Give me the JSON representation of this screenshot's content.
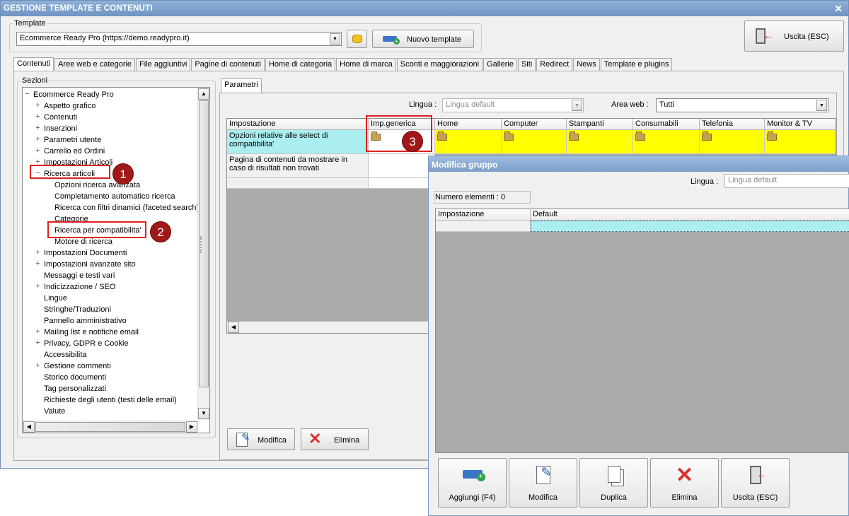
{
  "window": {
    "title": "GESTIONE TEMPLATE E CONTENUTI",
    "close": "✕"
  },
  "template_group": {
    "legend": "Template",
    "selected": "Ecommerce Ready Pro (https://demo.readypro.it)",
    "new_button": "Nuovo template"
  },
  "exit_button": "Uscita (ESC)",
  "tabs": [
    "Contenuti",
    "Aree web e categorie",
    "File aggiuntivi",
    "Pagine di contenuti",
    "Home di categoria",
    "Home di marca",
    "Sconti e maggiorazioni",
    "Gallerie",
    "Siti",
    "Redirect",
    "News",
    "Template e plugins"
  ],
  "sections": {
    "legend": "Sezioni",
    "root": "Ecommerce Ready Pro",
    "items": [
      {
        "label": "Aspetto grafico",
        "exp": "+"
      },
      {
        "label": "Contenuti",
        "exp": "+"
      },
      {
        "label": "Inserzioni",
        "exp": "+"
      },
      {
        "label": "Parametri utente",
        "exp": "+"
      },
      {
        "label": "Carrello ed Ordini",
        "exp": "+"
      },
      {
        "label": "Impostazioni Articoli",
        "exp": "+"
      },
      {
        "label": "Ricerca articoli",
        "exp": "−"
      },
      {
        "label": "Opzioni ricerca avanzata",
        "exp": "",
        "child": true
      },
      {
        "label": "Completamento automatico ricerca",
        "exp": "",
        "child": true
      },
      {
        "label": "Ricerca con filtri dinamici (faceted search)",
        "exp": "",
        "child": true
      },
      {
        "label": "Categorie",
        "exp": "",
        "child": true
      },
      {
        "label": "Ricerca per compatibilita'",
        "exp": "",
        "child": true
      },
      {
        "label": "Motore di ricerca",
        "exp": "",
        "child": true
      },
      {
        "label": "Impostazioni Documenti",
        "exp": "+"
      },
      {
        "label": "Impostazioni avanzate sito",
        "exp": "+"
      },
      {
        "label": "Messaggi e testi vari",
        "exp": ""
      },
      {
        "label": "Indicizzazione / SEO",
        "exp": "+"
      },
      {
        "label": "Lingue",
        "exp": ""
      },
      {
        "label": "Stringhe/Traduzioni",
        "exp": ""
      },
      {
        "label": "Pannello amministrativo",
        "exp": ""
      },
      {
        "label": "Mailing list e notifiche email",
        "exp": "+"
      },
      {
        "label": "Privacy, GDPR e Cookie",
        "exp": "+"
      },
      {
        "label": "Accessibilita",
        "exp": ""
      },
      {
        "label": "Gestione commenti",
        "exp": "+"
      },
      {
        "label": "Storico documenti",
        "exp": ""
      },
      {
        "label": "Tag personalizzati",
        "exp": ""
      },
      {
        "label": "Richieste degli utenti (testi delle email)",
        "exp": ""
      },
      {
        "label": "Valute",
        "exp": ""
      }
    ]
  },
  "params": {
    "tab": "Parametri",
    "lingua_label": "Lingua :",
    "lingua_value": "Lingua default",
    "area_label": "Area web :",
    "area_value": "Tutti",
    "columns": [
      "Impostazione",
      "Imp.generica",
      "Home",
      "Computer",
      "Stampanti",
      "Consumabili",
      "Telefonia",
      "Monitor & TV"
    ],
    "rows": [
      "Opzioni relative alle select di compatibilita'",
      "Pagina di contenuti da mostrare in caso di risultati non trovati"
    ],
    "modifica": "Modifica",
    "elimina": "Elimina"
  },
  "badges": [
    "1",
    "2",
    "3"
  ],
  "dialog": {
    "title": "Modifica gruppo",
    "lingua_label": "Lingua :",
    "lingua_value": "Lingua default",
    "count": "Numero elementi : 0",
    "columns": [
      "Impostazione",
      "Default"
    ],
    "buttons": [
      "Aggiungi (F4)",
      "Modifica",
      "Duplica",
      "Elimina",
      "Uscita (ESC)"
    ]
  }
}
